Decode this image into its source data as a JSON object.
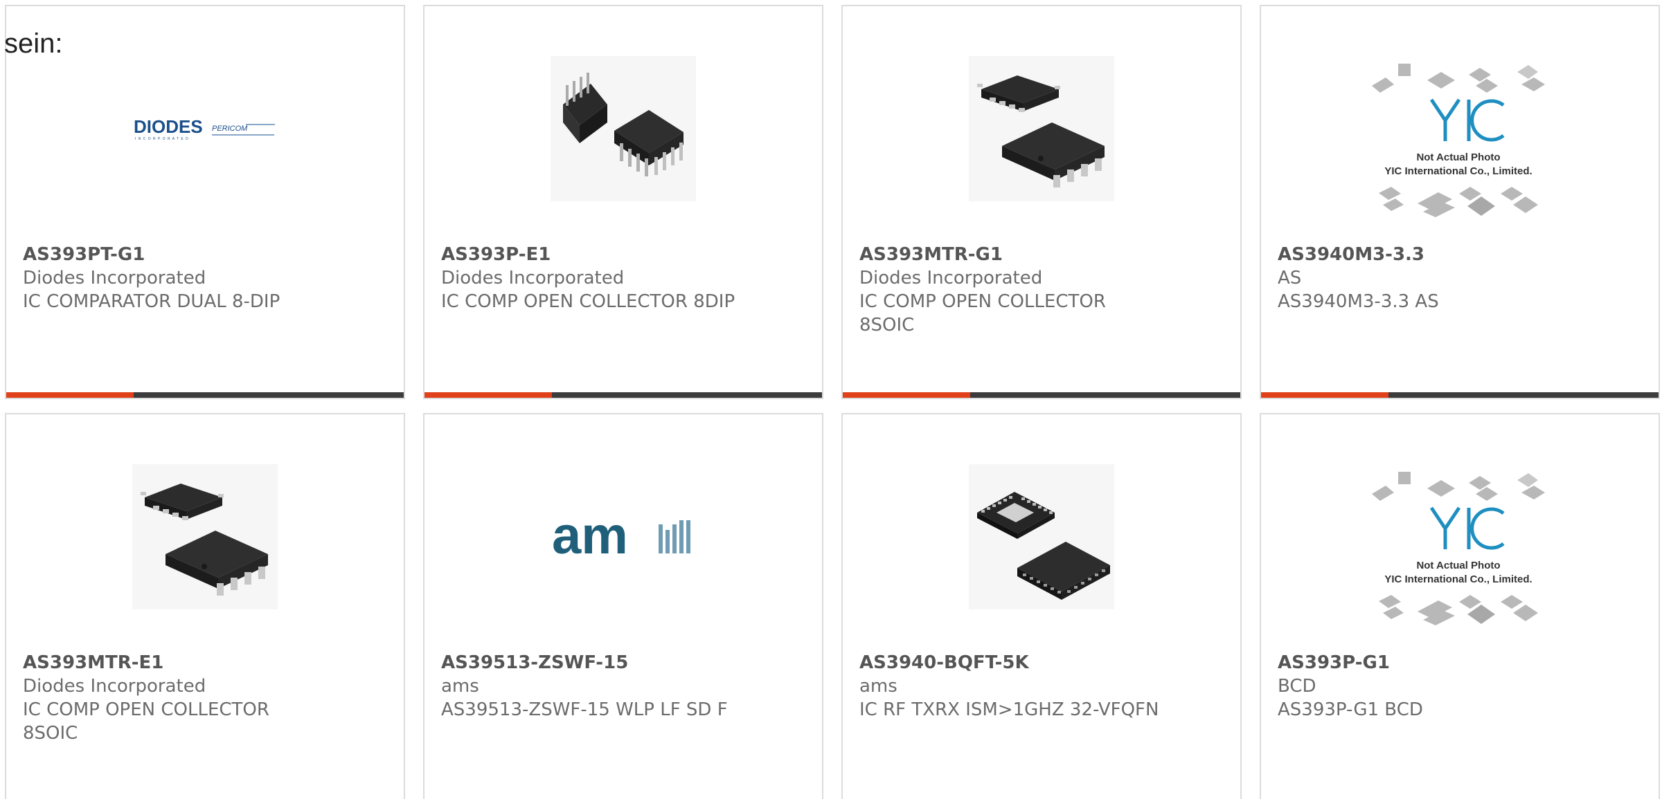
{
  "prefix_text": "sein:",
  "accent_color": "#e0401a",
  "bar_color": "#3c3c3c",
  "products": [
    {
      "part": "AS393PT-G1",
      "maker": "Diodes Incorporated",
      "desc": "IC COMPARATOR DUAL 8-DIP",
      "image": "diodes-pericom-logo",
      "logo": {
        "brand": "DIODES",
        "sub": "PERICOM"
      },
      "progress": 0.32
    },
    {
      "part": "AS393P-E1",
      "maker": "Diodes Incorporated",
      "desc": "IC COMP OPEN COLLECTOR 8DIP",
      "image": "dip-8-chip-photo",
      "progress": 0.32
    },
    {
      "part": "AS393MTR-G1",
      "maker": "Diodes Incorporated",
      "desc": "IC COMP OPEN COLLECTOR 8SOIC",
      "image": "soic-8-chip-photo",
      "progress": 0.32
    },
    {
      "part": "AS3940M3-3.3",
      "maker": "AS",
      "desc": "AS3940M3-3.3 AS",
      "image": "yic-placeholder",
      "placeholder": {
        "logo": "YIC",
        "line1": "Not Actual Photo",
        "line2": "YIC International Co., Limited."
      },
      "progress": 0.32
    },
    {
      "part": "AS393MTR-E1",
      "maker": "Diodes Incorporated",
      "desc": "IC COMP OPEN COLLECTOR 8SOIC",
      "image": "soic-8-chip-photo"
    },
    {
      "part": "AS39513-ZSWF-15",
      "maker": "ams",
      "desc": "AS39513-ZSWF-15 WLP LF SD F",
      "image": "ams-logo",
      "logo": {
        "brand": "am"
      }
    },
    {
      "part": "AS3940-BQFT-5K",
      "maker": "ams",
      "desc": "IC RF TXRX ISM>1GHZ 32-VFQFN",
      "image": "qfn-32-chip-photo"
    },
    {
      "part": "AS393P-G1",
      "maker": "BCD",
      "desc": "AS393P-G1 BCD",
      "image": "yic-placeholder",
      "placeholder": {
        "logo": "YIC",
        "line1": "Not Actual Photo",
        "line2": "YIC International Co., Limited."
      }
    }
  ]
}
